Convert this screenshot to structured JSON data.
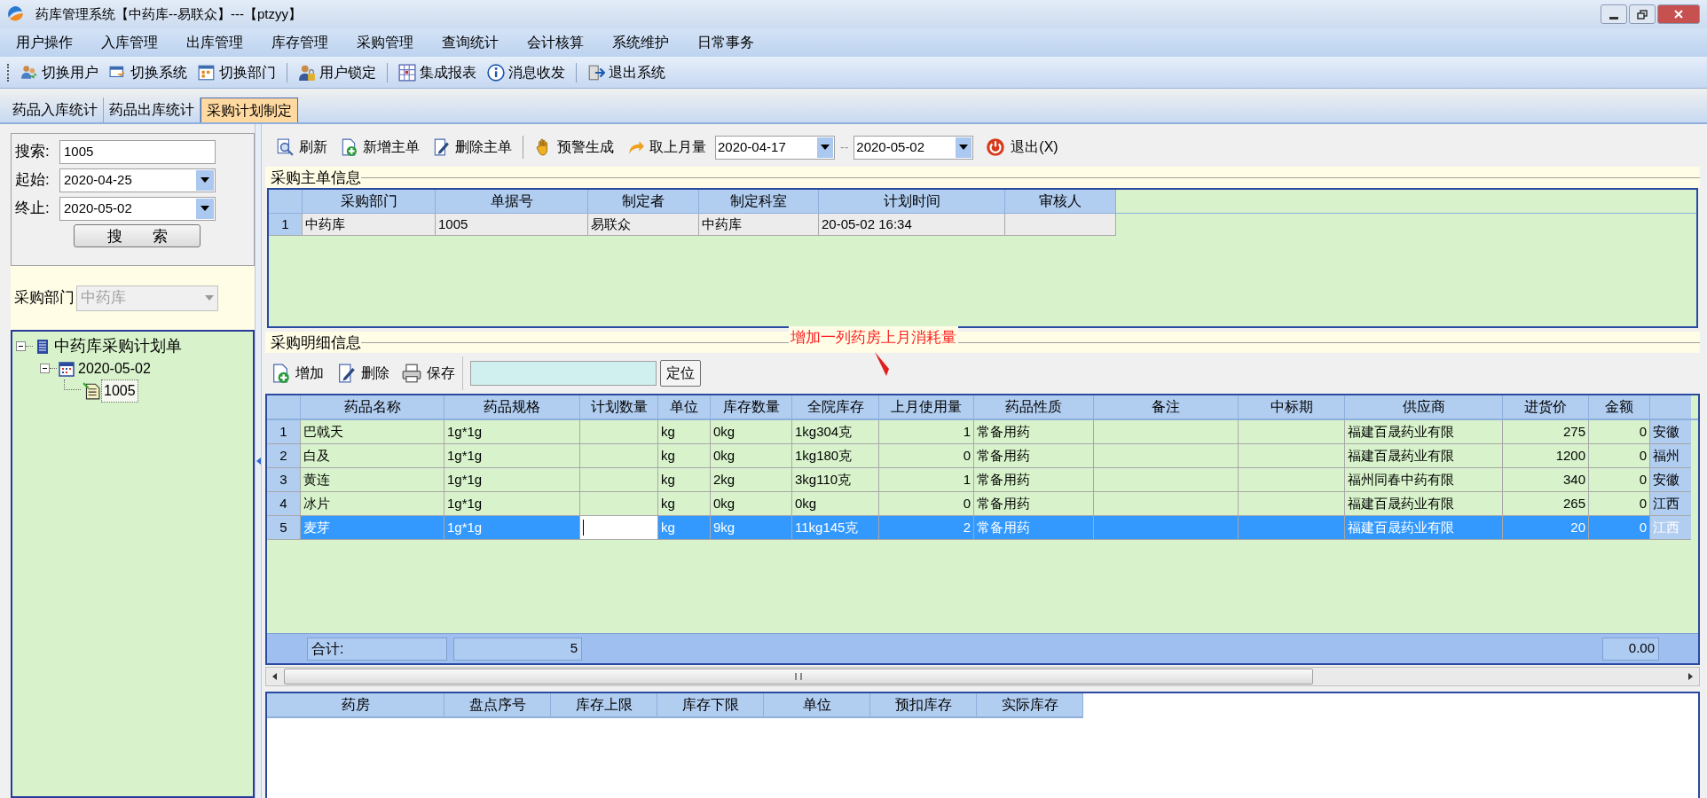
{
  "window": {
    "title": "药库管理系统【中药库--易联众】---【ptzyy】"
  },
  "menu": [
    "用户操作",
    "入库管理",
    "出库管理",
    "库存管理",
    "采购管理",
    "查询统计",
    "会计核算",
    "系统维护",
    "日常事务"
  ],
  "toolbar": [
    [
      "切换用户",
      "切换系统",
      "切换部门"
    ],
    [
      "用户锁定"
    ],
    [
      "集成报表",
      "消息收发"
    ],
    [
      "退出系统"
    ]
  ],
  "tabs": [
    {
      "label": "药品入库统计",
      "selected": false
    },
    {
      "label": "药品出库统计",
      "selected": false
    },
    {
      "label": "采购计划制定",
      "selected": true
    }
  ],
  "search_panel": {
    "search_label": "搜索:",
    "search_value": "1005",
    "start_label": "起始:",
    "start_value": "2020-04-25",
    "end_label": "终止:",
    "end_value": "2020-05-02",
    "button": "搜　　索"
  },
  "department_filter": {
    "label": "采购部门",
    "value": "中药库",
    "disabled": true
  },
  "tree": [
    {
      "label": "中药库采购计划单",
      "expanded": true,
      "selected": false,
      "children": [
        {
          "label": "2020-05-02",
          "expanded": true,
          "selected": false,
          "children": [
            {
              "label": "1005",
              "selected": true
            }
          ]
        }
      ]
    }
  ],
  "main_toolbar": {
    "groups": [
      [
        "刷新",
        "新增主单",
        "删除主单"
      ],
      [
        "预警生成",
        "取上月量"
      ]
    ],
    "date_from": "2020-04-17",
    "date_separator": "--",
    "date_to": "2020-05-02",
    "exit": "退出(X)"
  },
  "master": {
    "title": "采购主单信息",
    "columns": [
      "采购部门",
      "单据号",
      "制定者",
      "制定科室",
      "计划时间",
      "审核人"
    ],
    "rows": [
      {
        "index": "1",
        "cells": [
          "中药库",
          "1005",
          "易联众",
          "中药库",
          "20-05-02 16:34",
          null
        ]
      }
    ]
  },
  "detail": {
    "title": "采购明细信息",
    "annotation": "增加一列药房上月消耗量",
    "toolbar": [
      "增加",
      "删除",
      "保存"
    ],
    "locate_button": "定位",
    "columns": [
      "药品名称",
      "药品规格",
      "计划数量",
      "单位",
      "库存数量",
      "全院库存",
      "上月使用量",
      "药品性质",
      "备注",
      "中标期",
      "供应商",
      "进货价",
      "金额"
    ],
    "rows": [
      {
        "index": "1",
        "selected": false,
        "cells": [
          "巴戟天",
          "1g*1g",
          null,
          "kg",
          "0kg",
          "1kg304克",
          "1",
          "常备用药",
          null,
          null,
          "福建百晟药业有限",
          "275",
          "0",
          "安徽"
        ]
      },
      {
        "index": "2",
        "selected": false,
        "cells": [
          "白及",
          "1g*1g",
          null,
          "kg",
          "0kg",
          "1kg180克",
          "0",
          "常备用药",
          null,
          null,
          "福建百晟药业有限",
          "1200",
          "0",
          "福州"
        ]
      },
      {
        "index": "3",
        "selected": false,
        "cells": [
          "黄连",
          "1g*1g",
          null,
          "kg",
          "2kg",
          "3kg110克",
          "1",
          "常备用药",
          null,
          null,
          "福州同春中药有限",
          "340",
          "0",
          "安徽"
        ]
      },
      {
        "index": "4",
        "selected": false,
        "cells": [
          "冰片",
          "1g*1g",
          null,
          "kg",
          "0kg",
          "0kg",
          "0",
          "常备用药",
          null,
          null,
          "福建百晟药业有限",
          "265",
          "0",
          "江西"
        ]
      },
      {
        "index": "5",
        "selected": true,
        "cells": [
          "麦芽",
          "1g*1g",
          null,
          "kg",
          "9kg",
          "11kg145克",
          "2",
          "常备用药",
          null,
          null,
          "福建百晟药业有限",
          "20",
          "0",
          "江西"
        ]
      }
    ],
    "summary": {
      "label": "合计:",
      "count": "5",
      "amount": "0.00"
    }
  },
  "stock": {
    "columns": [
      "药房",
      "盘点序号",
      "库存上限",
      "库存下限",
      "单位",
      "预扣库存",
      "实际库存"
    ]
  }
}
